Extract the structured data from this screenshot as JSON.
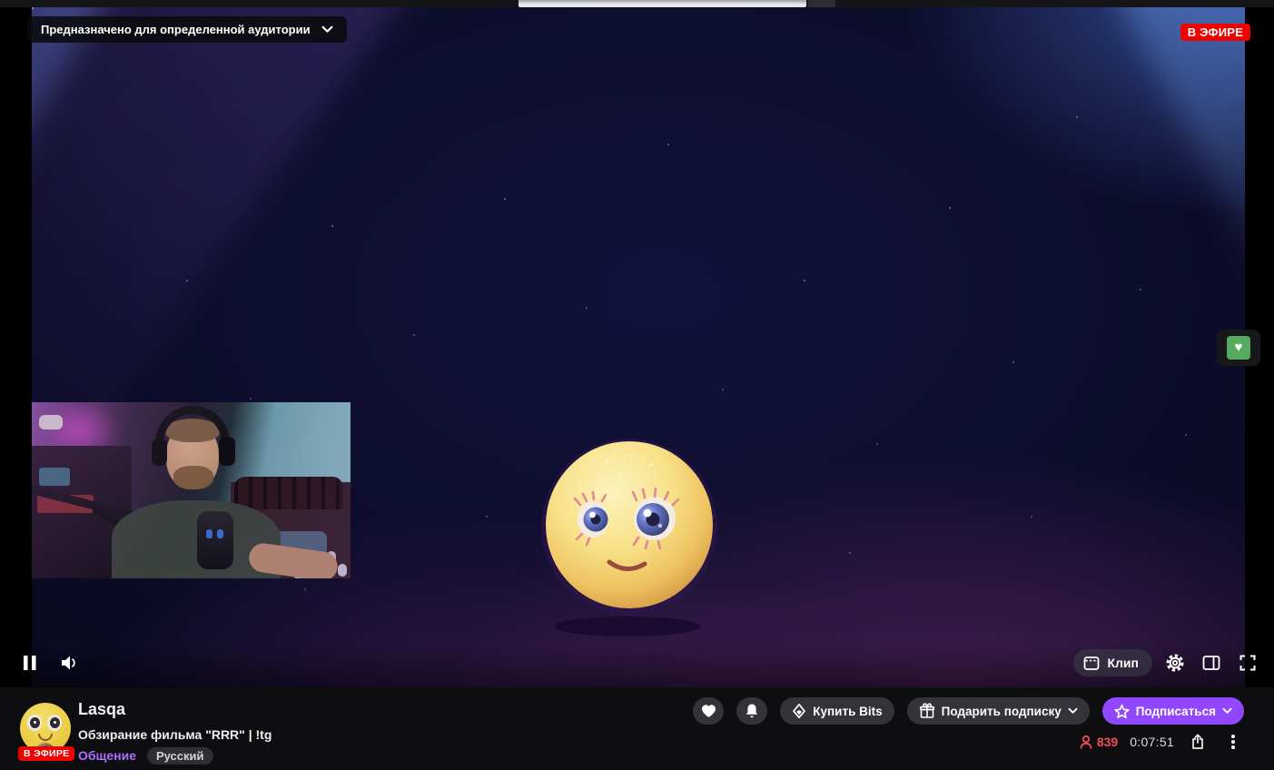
{
  "player": {
    "content_warning": "Предназначено для определенной аудитории",
    "live_badge": "В ЭФИРЕ",
    "controls": {
      "clip_label": "Клип"
    }
  },
  "channel": {
    "name": "Lasqa",
    "live_badge": "В ЭФИРЕ",
    "title": "Обзирание фильма \"RRR\" | !tg",
    "category": "Общение",
    "tags": [
      "Русский"
    ]
  },
  "actions": {
    "buy_bits_label": "Купить Bits",
    "gift_sub_label": "Подарить подписку",
    "subscribe_label": "Подписаться"
  },
  "stats": {
    "viewers": "839",
    "uptime": "0:07:51"
  },
  "icons": {
    "ext_heart_glyph": "♥"
  },
  "colors": {
    "accent_purple": "#9147ff",
    "live_red": "#eb0400",
    "viewer_count_red": "#f14e5a",
    "category_link_purple": "#a970ff",
    "ext_heart_green": "#54ab60",
    "page_background": "#0e0e10"
  }
}
